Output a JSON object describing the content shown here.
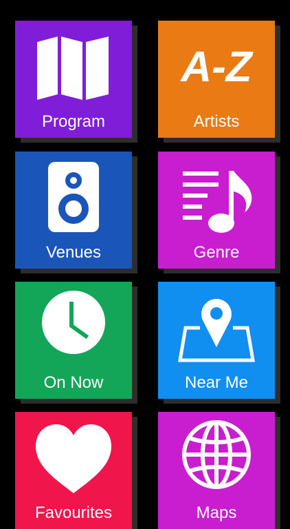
{
  "tiles": [
    {
      "label": "Program",
      "icon": "map-icon",
      "color": "#7f1dd8"
    },
    {
      "label": "Artists",
      "icon": "a-z-icon",
      "color": "#ea7a14"
    },
    {
      "label": "Venues",
      "icon": "speaker-icon",
      "color": "#1a56b9"
    },
    {
      "label": "Genre",
      "icon": "music-list-icon",
      "color": "#c81ecf"
    },
    {
      "label": "On Now",
      "icon": "clock-icon",
      "color": "#13a659"
    },
    {
      "label": "Near Me",
      "icon": "map-pin-icon",
      "color": "#118ff0"
    },
    {
      "label": "Favourites",
      "icon": "heart-icon",
      "color": "#f0154a"
    },
    {
      "label": "Maps",
      "icon": "globe-icon",
      "color": "#c81ecf"
    }
  ],
  "icon_text": {
    "a_z": "A-Z"
  }
}
